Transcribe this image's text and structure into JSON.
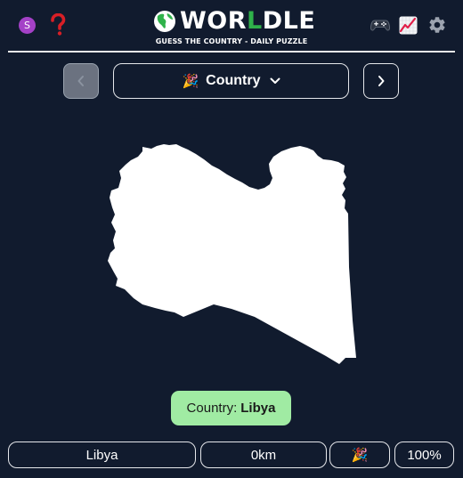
{
  "header": {
    "avatar_letter": "S",
    "logo_part1": "WOR",
    "logo_accent": "L",
    "logo_part2": "DLE",
    "tagline": "GUESS THE COUNTRY - DAILY PUZZLE"
  },
  "nav": {
    "mode_emoji": "🎉",
    "mode_label": "Country"
  },
  "answer": {
    "prefix": "Country:",
    "value": "Libya"
  },
  "guess": {
    "country": "Libya",
    "distance": "0km",
    "direction_emoji": "🎉",
    "proximity": "100%"
  },
  "colors": {
    "background": "#111b2e",
    "accent": "#2fb24a",
    "answer_badge": "#a0eba3",
    "avatar": "#a441c7"
  }
}
